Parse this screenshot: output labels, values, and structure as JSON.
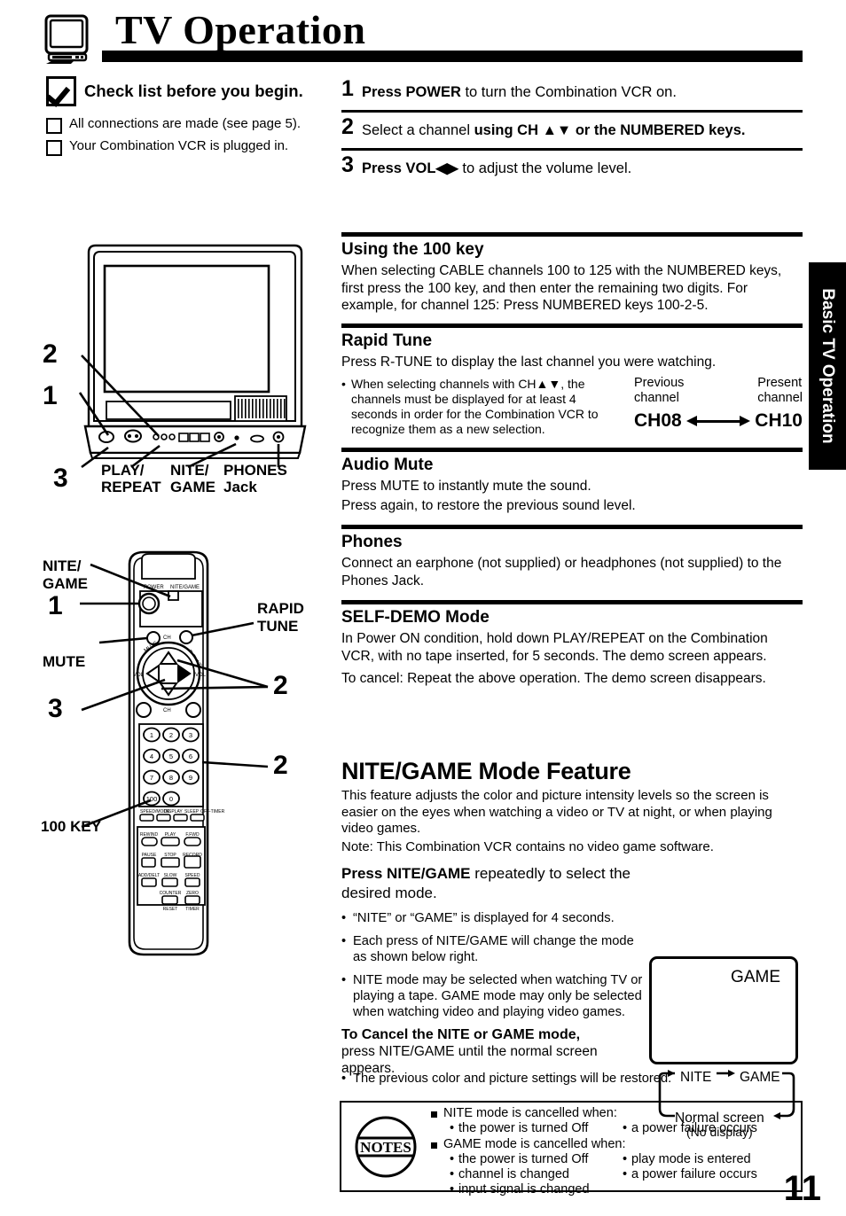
{
  "header": {
    "title": "TV Operation",
    "tv_icon": "tv-set-icon"
  },
  "checklist": {
    "heading": "Check list before you begin.",
    "items": [
      "All connections are made (see page 5).",
      "Your Combination VCR is plugged in."
    ]
  },
  "steps": [
    {
      "num": "1",
      "bold1": "Press POWER",
      "rest": " to turn the Combination VCR on.",
      "bold2": ""
    },
    {
      "num": "2",
      "bold1": "",
      "rest": "Select a channel ",
      "bold2": "using CH ▲▼  or the NUMBERED keys."
    },
    {
      "num": "3",
      "bold1": "Press VOL◀▶",
      "rest": "  to adjust the volume level.",
      "bold2": ""
    }
  ],
  "sections": {
    "hundred_key": {
      "heading": "Using the 100 key",
      "body": "When selecting CABLE channels 100 to 125 with the NUMBERED keys, first press the 100 key, and then enter the remaining two digits. For example, for channel 125: Press NUMBERED keys 100-2-5."
    },
    "rapid_tune": {
      "heading": "Rapid Tune",
      "body": "Press R-TUNE to display the last channel you were watching.",
      "bullet": "When selecting channels with CH▲▼, the channels must be displayed for at least 4 seconds in order for the Combination VCR to recognize them as a new selection.",
      "prev_label": "Previous\nchannel",
      "prev_label_l1": "Previous",
      "prev_label_l2": "channel",
      "present_label_l1": "Present",
      "present_label_l2": "channel",
      "prev_channel": "CH08",
      "present_channel": "CH10"
    },
    "audio_mute": {
      "heading": "Audio Mute",
      "line1": "Press MUTE to instantly mute the sound.",
      "line2": "Press again, to restore the previous sound level."
    },
    "phones": {
      "heading": "Phones",
      "body": "Connect an earphone (not supplied) or headphones (not supplied) to the Phones Jack."
    },
    "self_demo": {
      "heading": "SELF-DEMO Mode",
      "line1": "In Power ON condition, hold down PLAY/REPEAT on the Combination VCR, with no tape inserted, for 5 seconds. The demo screen appears.",
      "line2": "To cancel: Repeat the above operation. The demo screen disappears."
    }
  },
  "nitegame": {
    "title": "NITE/GAME Mode Feature",
    "intro1": "This feature adjusts the color and picture intensity levels so the screen is easier on the eyes when watching a video or TV at night, or when playing video games.",
    "intro2": "Note: This Combination VCR contains no video game software.",
    "press_bold": "Press NITE/GAME",
    "press_rest": " repeatedly to select the desired mode.",
    "bullets": [
      "“NITE” or “GAME” is displayed for 4 seconds.",
      "Each press of NITE/GAME will change the mode as shown below right.",
      "NITE mode may be selected when watching TV or playing a tape. GAME mode may only be selected when watching video and playing video games."
    ],
    "cancel_bold": "To Cancel the NITE or GAME mode,",
    "cancel_rest": "press NITE/GAME until the normal screen appears.",
    "cancel_bullet": "The previous color and picture settings will be restored.",
    "screen_label": "GAME",
    "cycle": {
      "nite": "NITE",
      "game": "GAME",
      "normal": "Normal screen",
      "nodisplay": "(No display)"
    }
  },
  "notes": {
    "badge": "NOTES",
    "groups": [
      {
        "heading": "NITE mode is cancelled when:",
        "left": [
          "the power is turned Off"
        ],
        "right": [
          "a power failure occurs"
        ]
      },
      {
        "heading": "GAME mode is cancelled when:",
        "left": [
          "the power is turned Off",
          "channel is changed",
          "input signal is changed"
        ],
        "right": [
          "play mode is entered",
          "a power failure occurs"
        ]
      }
    ]
  },
  "side_tab": {
    "label": "Basic TV Operation"
  },
  "page_number": "11",
  "tv_figure": {
    "callouts": [
      "PLAY/\nREPEAT",
      "NITE/\nGAME",
      "PHONES\nJack"
    ],
    "callout_play_l1": "PLAY/",
    "callout_play_l2": "REPEAT",
    "callout_nite_l1": "NITE/",
    "callout_nite_l2": "GAME",
    "callout_phones_l1": "PHONES",
    "callout_phones_l2": "Jack",
    "num_1": "1",
    "num_2": "2",
    "num_3": "3"
  },
  "remote_figure": {
    "nite_l1": "NITE/",
    "nite_l2": "GAME",
    "mute": "MUTE",
    "rapid_l1": "RAPID",
    "rapid_l2": "TUNE",
    "hundred_key": "100 KEY",
    "num_1": "1",
    "num_2": "2",
    "num_2b": "2",
    "num_3": "3",
    "keypad": [
      "1",
      "2",
      "3",
      "4",
      "5",
      "6",
      "7",
      "8",
      "9",
      "100",
      "0"
    ]
  }
}
